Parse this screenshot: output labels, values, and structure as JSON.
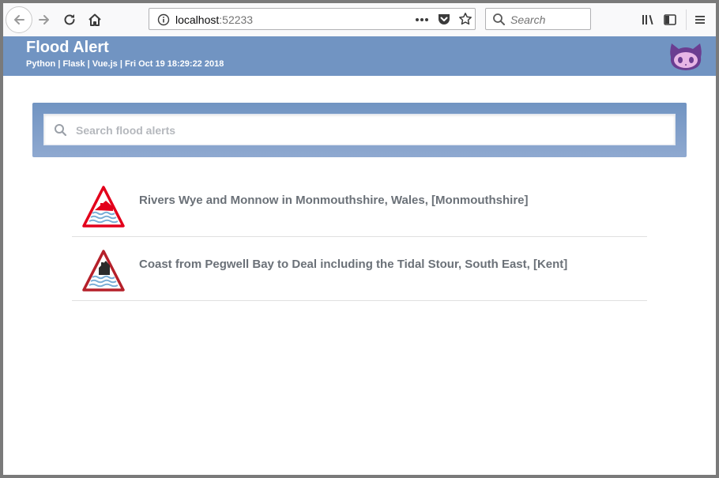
{
  "browser": {
    "url_host": "localhost",
    "url_port": ":52233",
    "search_placeholder": "Search"
  },
  "header": {
    "title": "Flood Alert",
    "subtitle": "Python | Flask | Vue.js | Fri Oct 19 18:29:22 2018"
  },
  "search": {
    "placeholder": "Search flood alerts"
  },
  "alerts": [
    {
      "description": "Rivers Wye and Monnow in Monmouthshire, Wales, [Monmouthshire]",
      "icon": "flood-warning-icon",
      "icon_color": "#e3001b"
    },
    {
      "description": "Coast from Pegwell Bay to Deal including the Tidal Stour, South East, [Kent]",
      "icon": "flood-alert-icon",
      "icon_color": "#2b2b2b"
    }
  ],
  "colors": {
    "header_bg": "#7194c2",
    "github_purple": "#6b3d91"
  }
}
